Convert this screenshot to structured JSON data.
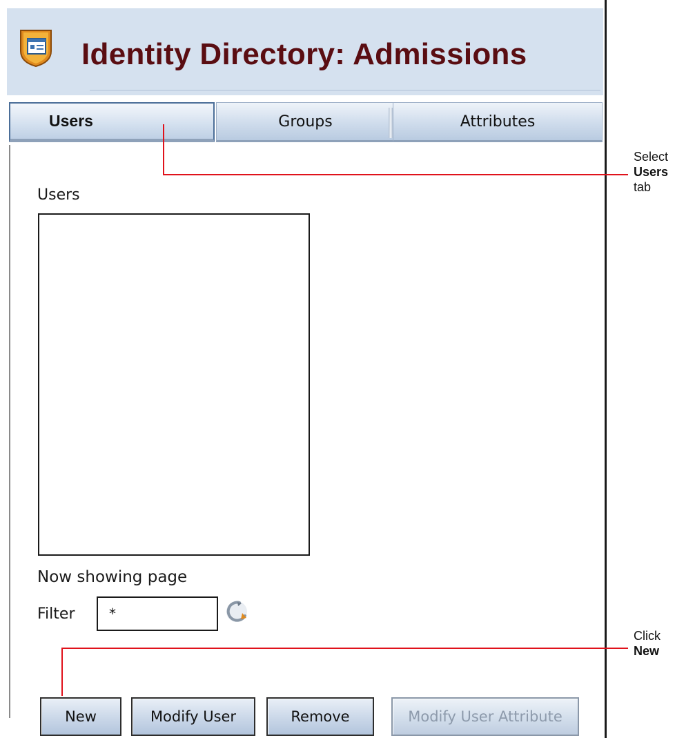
{
  "header": {
    "title": "Identity Directory: Admissions",
    "icon": "directory-app-icon"
  },
  "tabs": [
    {
      "label": "Users",
      "active": true
    },
    {
      "label": "Groups",
      "active": false
    },
    {
      "label": "Attributes",
      "active": false
    }
  ],
  "users_panel": {
    "list_label": "Users",
    "paging_text": "Now showing page",
    "filter_label": "Filter",
    "filter_value": "*",
    "refresh_icon": "refresh-icon"
  },
  "buttons": {
    "new": "New",
    "modify_user": "Modify User",
    "remove": "Remove",
    "modify_user_attribute": "Modify User Attribute"
  },
  "callouts": {
    "select_users": {
      "line1": "Select",
      "bold": "Users",
      "line3": "tab"
    },
    "click_new": {
      "line1": "Click",
      "bold": "New"
    }
  },
  "colors": {
    "title": "#5a0d12",
    "header_bg": "#d5e1ef",
    "callout_line": "#e0121b",
    "disabled_text": "#8d9aab"
  }
}
